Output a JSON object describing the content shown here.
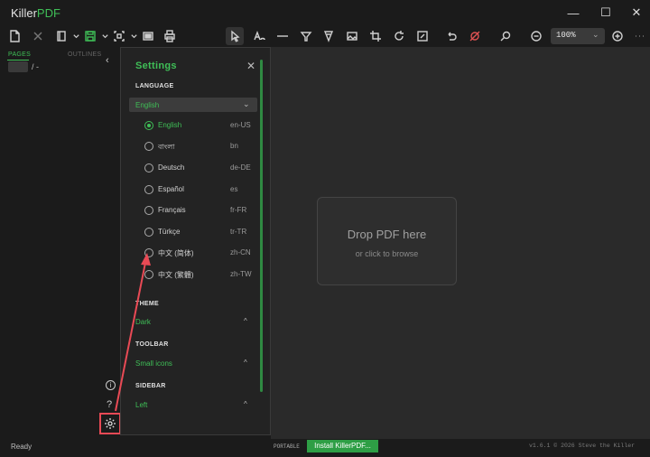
{
  "app": {
    "title_prefix": "Killer",
    "title_accent": "PDF",
    "window_controls": {
      "minimize": "—",
      "maximize": "☐",
      "close": "✕"
    }
  },
  "toolbar": {
    "icons": [
      "new-document-icon",
      "close-document-icon",
      "page-layout-icon",
      "save-icon",
      "ocr-scan-icon",
      "screen-icon",
      "print-icon",
      "select-cursor-icon",
      "text-tool-icon",
      "line-tool-icon",
      "highlight-tool-icon",
      "pen-tool-icon",
      "image-tool-icon",
      "crop-icon",
      "rotate-icon",
      "edit-icon",
      "undo-icon",
      "clear-icon",
      "search-icon",
      "zoom-out-icon",
      "zoom-in-icon"
    ],
    "zoom_value": "100%",
    "zoom_chevron": "⌄"
  },
  "sidebar": {
    "tab_pages": "PAGES",
    "tab_outlines": "OUTLINES",
    "page_separator": "/ -",
    "collapse": "‹",
    "info": "i",
    "help": "?"
  },
  "settings": {
    "title": "Settings",
    "close": "✕",
    "language_heading": "LANGUAGE",
    "language_selected": "English",
    "languages": [
      {
        "name": "English",
        "code": "en-US",
        "selected": true
      },
      {
        "name": "বাংলা",
        "code": "bn",
        "selected": false
      },
      {
        "name": "Deutsch",
        "code": "de-DE",
        "selected": false
      },
      {
        "name": "Español",
        "code": "es",
        "selected": false
      },
      {
        "name": "Français",
        "code": "fr-FR",
        "selected": false
      },
      {
        "name": "Türkçe",
        "code": "tr-TR",
        "selected": false
      },
      {
        "name": "中文 (简体)",
        "code": "zh-CN",
        "selected": false
      },
      {
        "name": "中文 (繁體)",
        "code": "zh-TW",
        "selected": false
      }
    ],
    "theme_heading": "THEME",
    "theme_value": "Dark",
    "toolbar_heading": "TOOLBAR",
    "toolbar_value": "Small icons",
    "sidebar_heading": "SIDEBAR",
    "sidebar_value": "Left",
    "expand_chevron": "^"
  },
  "viewer": {
    "drop_title": "Drop PDF here",
    "drop_subtitle": "or click to browse"
  },
  "status": {
    "text": "Ready",
    "portable": "PORTABLE",
    "install_label": "Install KillerPDF...",
    "version": "v1.6.1 © 2026 Steve the Killer"
  },
  "colors": {
    "accent": "#3fbf57",
    "highlight_annotation": "#e84a55"
  }
}
